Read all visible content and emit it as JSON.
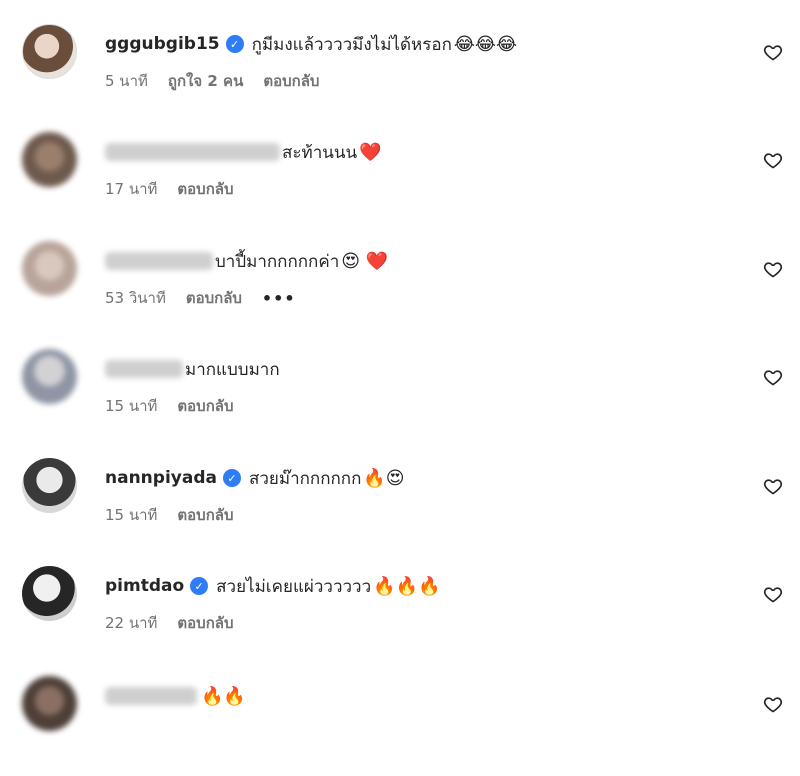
{
  "comments": [
    {
      "username": "gggubgib15",
      "verified": true,
      "text": "กูมีมงแล้ววววมึงไม่ได้หรอก",
      "emoji": "😂😂😂",
      "time": "5 นาที",
      "likes": "ถูกใจ 2 คน",
      "reply": "ตอบกลับ"
    },
    {
      "username": "",
      "verified": false,
      "text": "สะท้านนน",
      "emoji": "❤️",
      "time": "17 นาที",
      "reply": "ตอบกลับ"
    },
    {
      "username": "",
      "verified": false,
      "text": "บาปี้มากกกกกค่า",
      "emoji": "😍 ❤️",
      "time": "53 วินาที",
      "reply": "ตอบกลับ",
      "more": "•••"
    },
    {
      "username": "",
      "verified": false,
      "text": "มากแบบมาก",
      "emoji": "",
      "time": "15 นาที",
      "reply": "ตอบกลับ"
    },
    {
      "username": "nannpiyada",
      "verified": true,
      "text": "สวยม๊ากกกกกก",
      "emoji": "🔥😍",
      "time": "15 นาที",
      "reply": "ตอบกลับ"
    },
    {
      "username": "pimtdao",
      "verified": true,
      "text": "สวยไม่เคยแผ่วววววว",
      "emoji": "🔥🔥🔥",
      "time": "22 นาที",
      "reply": "ตอบกลับ"
    },
    {
      "username": "",
      "verified": false,
      "text": "",
      "emoji": "🔥🔥",
      "time": "",
      "reply": ""
    }
  ],
  "icons": {
    "heart": "heart-outline-icon",
    "verified": "verified-badge-icon"
  },
  "colors": {
    "verified": "#2f7df6",
    "meta": "#737373",
    "text": "#262626"
  }
}
